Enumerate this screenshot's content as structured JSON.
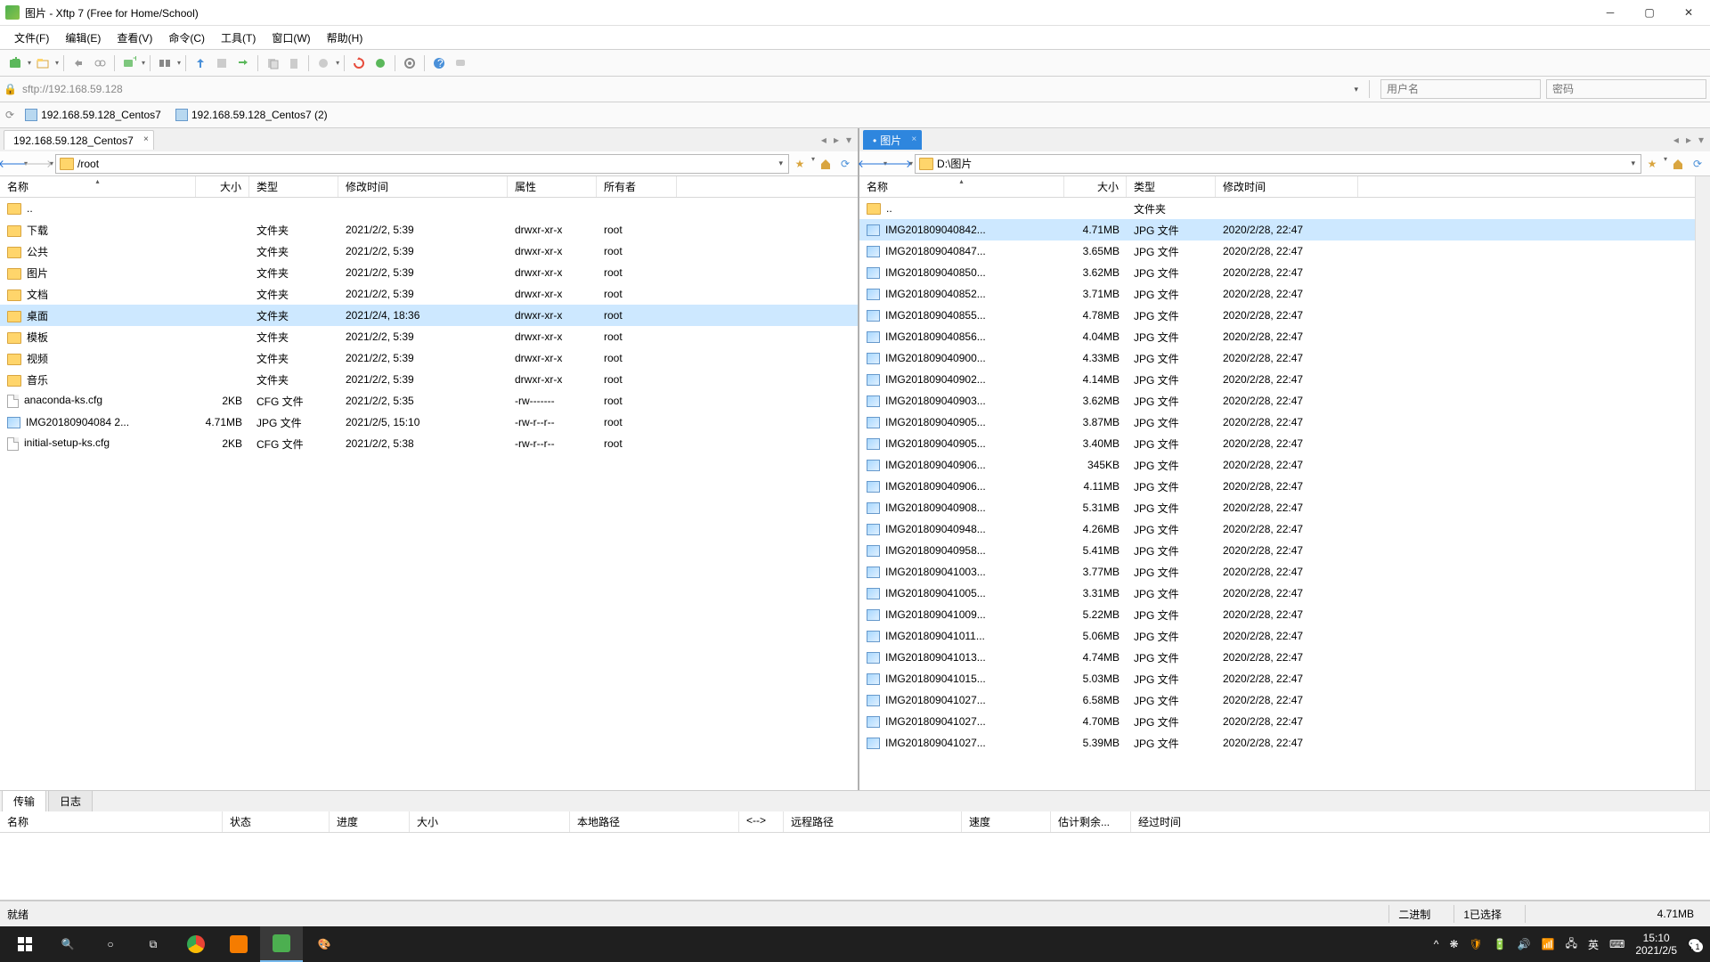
{
  "window": {
    "title": "图片 - Xftp 7 (Free for Home/School)"
  },
  "menu": {
    "file": "文件(F)",
    "edit": "编辑(E)",
    "view": "查看(V)",
    "cmd": "命令(C)",
    "tool": "工具(T)",
    "win": "窗口(W)",
    "help": "帮助(H)"
  },
  "address": {
    "value": "sftp://192.168.59.128",
    "user_ph": "用户名",
    "pass_ph": "密码"
  },
  "sessions": [
    {
      "label": "192.168.59.128_Centos7"
    },
    {
      "label": "192.168.59.128_Centos7 (2)"
    }
  ],
  "left": {
    "tab": "192.168.59.128_Centos7",
    "path": "/root",
    "cols": {
      "name": "名称",
      "size": "大小",
      "type": "类型",
      "mtime": "修改时间",
      "attr": "属性",
      "owner": "所有者"
    },
    "rows": [
      {
        "icon": "folder",
        "name": "..",
        "size": "",
        "type": "",
        "mtime": "",
        "attr": "",
        "owner": ""
      },
      {
        "icon": "folder",
        "name": "下载",
        "size": "",
        "type": "文件夹",
        "mtime": "2021/2/2, 5:39",
        "attr": "drwxr-xr-x",
        "owner": "root"
      },
      {
        "icon": "folder",
        "name": "公共",
        "size": "",
        "type": "文件夹",
        "mtime": "2021/2/2, 5:39",
        "attr": "drwxr-xr-x",
        "owner": "root"
      },
      {
        "icon": "folder",
        "name": "图片",
        "size": "",
        "type": "文件夹",
        "mtime": "2021/2/2, 5:39",
        "attr": "drwxr-xr-x",
        "owner": "root"
      },
      {
        "icon": "folder",
        "name": "文档",
        "size": "",
        "type": "文件夹",
        "mtime": "2021/2/2, 5:39",
        "attr": "drwxr-xr-x",
        "owner": "root"
      },
      {
        "icon": "folder",
        "name": "桌面",
        "size": "",
        "type": "文件夹",
        "mtime": "2021/2/4, 18:36",
        "attr": "drwxr-xr-x",
        "owner": "root",
        "sel": true
      },
      {
        "icon": "folder",
        "name": "模板",
        "size": "",
        "type": "文件夹",
        "mtime": "2021/2/2, 5:39",
        "attr": "drwxr-xr-x",
        "owner": "root"
      },
      {
        "icon": "folder",
        "name": "视频",
        "size": "",
        "type": "文件夹",
        "mtime": "2021/2/2, 5:39",
        "attr": "drwxr-xr-x",
        "owner": "root"
      },
      {
        "icon": "folder",
        "name": "音乐",
        "size": "",
        "type": "文件夹",
        "mtime": "2021/2/2, 5:39",
        "attr": "drwxr-xr-x",
        "owner": "root"
      },
      {
        "icon": "file",
        "name": "anaconda-ks.cfg",
        "size": "2KB",
        "type": "CFG 文件",
        "mtime": "2021/2/2, 5:35",
        "attr": "-rw-------",
        "owner": "root"
      },
      {
        "icon": "img",
        "name": "IMG20180904084 2...",
        "size": "4.71MB",
        "type": "JPG 文件",
        "mtime": "2021/2/5, 15:10",
        "attr": "-rw-r--r--",
        "owner": "root"
      },
      {
        "icon": "file",
        "name": "initial-setup-ks.cfg",
        "size": "2KB",
        "type": "CFG 文件",
        "mtime": "2021/2/2, 5:38",
        "attr": "-rw-r--r--",
        "owner": "root"
      }
    ]
  },
  "right": {
    "tab": "图片",
    "path": "D:\\图片",
    "cols": {
      "name": "名称",
      "size": "大小",
      "type": "类型",
      "mtime": "修改时间"
    },
    "rows": [
      {
        "icon": "folder",
        "name": "..",
        "size": "",
        "type": "文件夹",
        "mtime": ""
      },
      {
        "icon": "img",
        "name": "IMG201809040842...",
        "size": "4.71MB",
        "type": "JPG 文件",
        "mtime": "2020/2/28, 22:47",
        "sel": true
      },
      {
        "icon": "img",
        "name": "IMG201809040847...",
        "size": "3.65MB",
        "type": "JPG 文件",
        "mtime": "2020/2/28, 22:47"
      },
      {
        "icon": "img",
        "name": "IMG201809040850...",
        "size": "3.62MB",
        "type": "JPG 文件",
        "mtime": "2020/2/28, 22:47"
      },
      {
        "icon": "img",
        "name": "IMG201809040852...",
        "size": "3.71MB",
        "type": "JPG 文件",
        "mtime": "2020/2/28, 22:47"
      },
      {
        "icon": "img",
        "name": "IMG201809040855...",
        "size": "4.78MB",
        "type": "JPG 文件",
        "mtime": "2020/2/28, 22:47"
      },
      {
        "icon": "img",
        "name": "IMG201809040856...",
        "size": "4.04MB",
        "type": "JPG 文件",
        "mtime": "2020/2/28, 22:47"
      },
      {
        "icon": "img",
        "name": "IMG201809040900...",
        "size": "4.33MB",
        "type": "JPG 文件",
        "mtime": "2020/2/28, 22:47"
      },
      {
        "icon": "img",
        "name": "IMG201809040902...",
        "size": "4.14MB",
        "type": "JPG 文件",
        "mtime": "2020/2/28, 22:47"
      },
      {
        "icon": "img",
        "name": "IMG201809040903...",
        "size": "3.62MB",
        "type": "JPG 文件",
        "mtime": "2020/2/28, 22:47"
      },
      {
        "icon": "img",
        "name": "IMG201809040905...",
        "size": "3.87MB",
        "type": "JPG 文件",
        "mtime": "2020/2/28, 22:47"
      },
      {
        "icon": "img",
        "name": "IMG201809040905...",
        "size": "3.40MB",
        "type": "JPG 文件",
        "mtime": "2020/2/28, 22:47"
      },
      {
        "icon": "img",
        "name": "IMG201809040906...",
        "size": "345KB",
        "type": "JPG 文件",
        "mtime": "2020/2/28, 22:47"
      },
      {
        "icon": "img",
        "name": "IMG201809040906...",
        "size": "4.11MB",
        "type": "JPG 文件",
        "mtime": "2020/2/28, 22:47"
      },
      {
        "icon": "img",
        "name": "IMG201809040908...",
        "size": "5.31MB",
        "type": "JPG 文件",
        "mtime": "2020/2/28, 22:47"
      },
      {
        "icon": "img",
        "name": "IMG201809040948...",
        "size": "4.26MB",
        "type": "JPG 文件",
        "mtime": "2020/2/28, 22:47"
      },
      {
        "icon": "img",
        "name": "IMG201809040958...",
        "size": "5.41MB",
        "type": "JPG 文件",
        "mtime": "2020/2/28, 22:47"
      },
      {
        "icon": "img",
        "name": "IMG201809041003...",
        "size": "3.77MB",
        "type": "JPG 文件",
        "mtime": "2020/2/28, 22:47"
      },
      {
        "icon": "img",
        "name": "IMG201809041005...",
        "size": "3.31MB",
        "type": "JPG 文件",
        "mtime": "2020/2/28, 22:47"
      },
      {
        "icon": "img",
        "name": "IMG201809041009...",
        "size": "5.22MB",
        "type": "JPG 文件",
        "mtime": "2020/2/28, 22:47"
      },
      {
        "icon": "img",
        "name": "IMG201809041011...",
        "size": "5.06MB",
        "type": "JPG 文件",
        "mtime": "2020/2/28, 22:47"
      },
      {
        "icon": "img",
        "name": "IMG201809041013...",
        "size": "4.74MB",
        "type": "JPG 文件",
        "mtime": "2020/2/28, 22:47"
      },
      {
        "icon": "img",
        "name": "IMG201809041015...",
        "size": "5.03MB",
        "type": "JPG 文件",
        "mtime": "2020/2/28, 22:47"
      },
      {
        "icon": "img",
        "name": "IMG201809041027...",
        "size": "6.58MB",
        "type": "JPG 文件",
        "mtime": "2020/2/28, 22:47"
      },
      {
        "icon": "img",
        "name": "IMG201809041027...",
        "size": "4.70MB",
        "type": "JPG 文件",
        "mtime": "2020/2/28, 22:47"
      },
      {
        "icon": "img",
        "name": "IMG201809041027...",
        "size": "5.39MB",
        "type": "JPG 文件",
        "mtime": "2020/2/28, 22:47"
      }
    ]
  },
  "log": {
    "tab_transfer": "传输",
    "tab_log": "日志"
  },
  "transfer_cols": {
    "name": "名称",
    "status": "状态",
    "progress": "进度",
    "size": "大小",
    "local": "本地路径",
    "arrow": "<-->",
    "remote": "远程路径",
    "speed": "速度",
    "eta": "估计剩余...",
    "elapsed": "经过时间"
  },
  "status": {
    "ready": "就绪",
    "binary": "二进制",
    "selected": "1已选择",
    "size": "4.71MB"
  },
  "taskbar": {
    "time": "15:10",
    "date": "2021/2/5",
    "ime": "英",
    "ime2": "⌨",
    "notif": "1"
  }
}
